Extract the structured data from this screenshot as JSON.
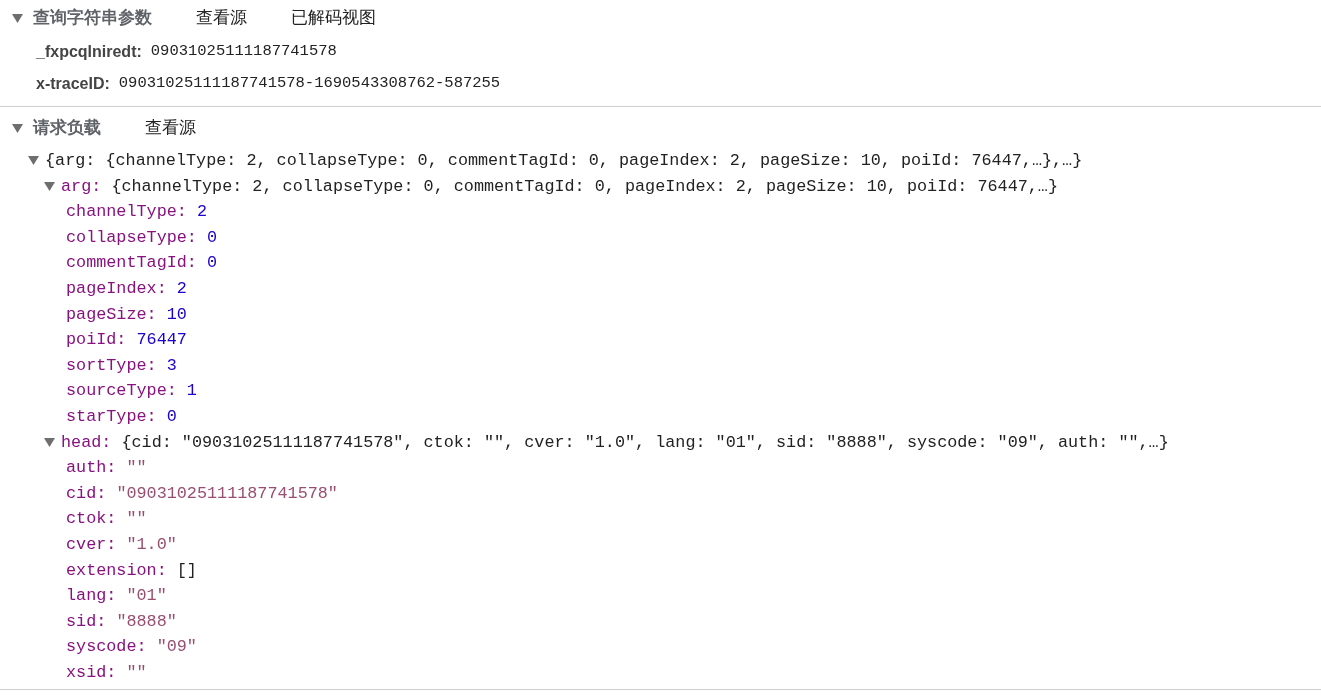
{
  "query_section": {
    "title": "查询字符串参数",
    "expanded": true,
    "actions": [
      "查看源",
      "已解码视图"
    ],
    "params": [
      {
        "name": "_fxpcqlniredt:",
        "value": "09031025111187741578"
      },
      {
        "name": "x-traceID:",
        "value": "09031025111187741578-1690543308762-587255"
      }
    ]
  },
  "payload_section": {
    "title": "请求负载",
    "expanded": true,
    "actions": [
      "查看源"
    ],
    "root": {
      "summary": "{arg: {channelType: 2, collapseType: 0, commentTagId: 0, pageIndex: 2, pageSize: 10, poiId: 76447,…},…}",
      "expanded": true,
      "children": [
        {
          "key": "arg:",
          "summary": "{channelType: 2, collapseType: 0, commentTagId: 0, pageIndex: 2, pageSize: 10, poiId: 76447,…}",
          "expanded": true,
          "children": [
            {
              "key": "channelType:",
              "value": "2",
              "kind": "number"
            },
            {
              "key": "collapseType:",
              "value": "0",
              "kind": "number"
            },
            {
              "key": "commentTagId:",
              "value": "0",
              "kind": "number"
            },
            {
              "key": "pageIndex:",
              "value": "2",
              "kind": "number"
            },
            {
              "key": "pageSize:",
              "value": "10",
              "kind": "number"
            },
            {
              "key": "poiId:",
              "value": "76447",
              "kind": "number"
            },
            {
              "key": "sortType:",
              "value": "3",
              "kind": "number"
            },
            {
              "key": "sourceType:",
              "value": "1",
              "kind": "number"
            },
            {
              "key": "starType:",
              "value": "0",
              "kind": "number"
            }
          ]
        },
        {
          "key": "head:",
          "summary": "{cid: \"09031025111187741578\", ctok: \"\", cver: \"1.0\", lang: \"01\", sid: \"8888\", syscode: \"09\", auth: \"\",…}",
          "expanded": true,
          "children": [
            {
              "key": "auth:",
              "value": "\"\"",
              "kind": "string"
            },
            {
              "key": "cid:",
              "value": "\"09031025111187741578\"",
              "kind": "string"
            },
            {
              "key": "ctok:",
              "value": "\"\"",
              "kind": "string"
            },
            {
              "key": "cver:",
              "value": "\"1.0\"",
              "kind": "string"
            },
            {
              "key": "extension:",
              "value": "[]",
              "kind": "array"
            },
            {
              "key": "lang:",
              "value": "\"01\"",
              "kind": "string"
            },
            {
              "key": "sid:",
              "value": "\"8888\"",
              "kind": "string"
            },
            {
              "key": "syscode:",
              "value": "\"09\"",
              "kind": "string"
            },
            {
              "key": "xsid:",
              "value": "\"\"",
              "kind": "string"
            }
          ]
        }
      ]
    }
  }
}
